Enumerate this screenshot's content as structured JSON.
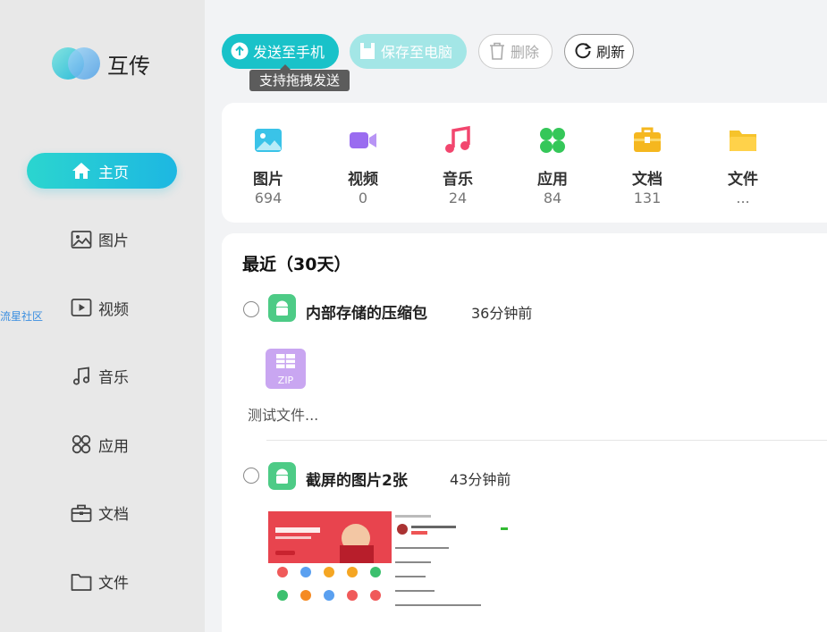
{
  "app": {
    "name": "互传"
  },
  "sidebar": {
    "items": [
      {
        "label": "主页",
        "icon": "home-icon",
        "active": true
      },
      {
        "label": "图片",
        "icon": "image-icon"
      },
      {
        "label": "视频",
        "icon": "video-icon"
      },
      {
        "label": "音乐",
        "icon": "music-icon"
      },
      {
        "label": "应用",
        "icon": "apps-icon"
      },
      {
        "label": "文档",
        "icon": "briefcase-icon"
      },
      {
        "label": "文件",
        "icon": "folder-icon"
      }
    ],
    "side_tag": "流星社区"
  },
  "toolbar": {
    "send_label": "发送至手机",
    "save_label": "保存至电脑",
    "delete_label": "删除",
    "refresh_label": "刷新",
    "tooltip": "支持拖拽发送"
  },
  "categories": [
    {
      "name": "图片",
      "count": "694",
      "icon": "image-icon",
      "color": "#3ac3e8"
    },
    {
      "name": "视频",
      "count": "0",
      "icon": "video-icon",
      "color": "#9a6cf0"
    },
    {
      "name": "音乐",
      "count": "24",
      "icon": "music-icon",
      "color": "#f2466e"
    },
    {
      "name": "应用",
      "count": "84",
      "icon": "apps-icon",
      "color": "#35c759"
    },
    {
      "name": "文档",
      "count": "131",
      "icon": "briefcase-icon",
      "color": "#f5b71f"
    },
    {
      "name": "文件",
      "count": "...",
      "icon": "folder-icon",
      "color": "#f6c32b"
    }
  ],
  "recent": {
    "title": "最近（30天）",
    "groups": [
      {
        "title": "内部存储的压缩包",
        "time": "36分钟前",
        "file_name": "测试文件...",
        "file_type": "ZIP"
      },
      {
        "title": "截屏的图片2张",
        "time": "43分钟前"
      }
    ]
  },
  "colors": {
    "accent": "#19c2c9",
    "sidebar_bg": "#e8e8e8"
  }
}
